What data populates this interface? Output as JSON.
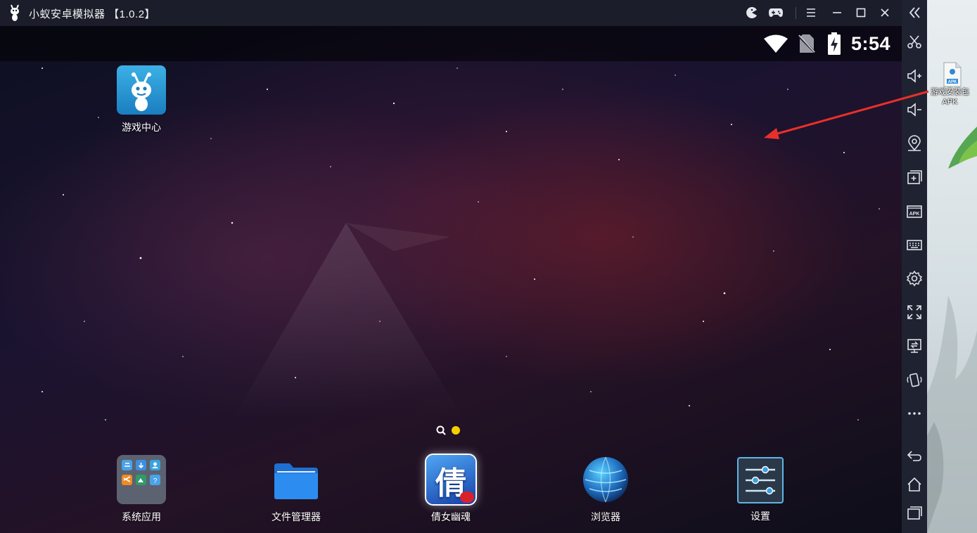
{
  "window": {
    "title": "小蚁安卓模拟器 【1.0.2】",
    "controls": [
      "pacman-icon",
      "gamepad-icon",
      "menu-icon",
      "minimize-icon",
      "maximize-icon",
      "close-icon"
    ],
    "collapse_icon": "double-chevron-left-icon"
  },
  "status_bar": {
    "icons": [
      "wifi-icon",
      "no-sim-icon",
      "battery-charging-icon"
    ],
    "time": "5:54"
  },
  "home_screen": {
    "top_apps": [
      {
        "label": "游戏中心",
        "icon": "ant-game-center-icon"
      }
    ],
    "dock_apps": [
      {
        "label": "系统应用",
        "icon": "folder-grid-icon"
      },
      {
        "label": "文件管理器",
        "icon": "blue-folder-icon"
      },
      {
        "label": "倩女幽魂",
        "icon": "game-qiannv-icon",
        "glyph": "倩"
      },
      {
        "label": "浏览器",
        "icon": "globe-icon"
      },
      {
        "label": "设置",
        "icon": "sliders-icon"
      }
    ],
    "pager": {
      "search_icon": "search-icon",
      "active_dot_color": "#f5d000"
    }
  },
  "sidebar": {
    "top_tools": [
      "scissors-icon",
      "volume-up-icon",
      "volume-down-icon",
      "location-icon",
      "multi-window-icon",
      "apk-install-icon",
      "keyboard-icon",
      "settings-icon",
      "fullscreen-icon",
      "screen-share-icon",
      "shake-icon",
      "more-icon"
    ],
    "nav": [
      "back-icon",
      "home-icon",
      "recents-icon"
    ]
  },
  "desktop": {
    "file_label_line1": "游戏安装包",
    "file_label_line2": "APK",
    "file_badge": "APK",
    "arrow_color": "#e8302a"
  }
}
